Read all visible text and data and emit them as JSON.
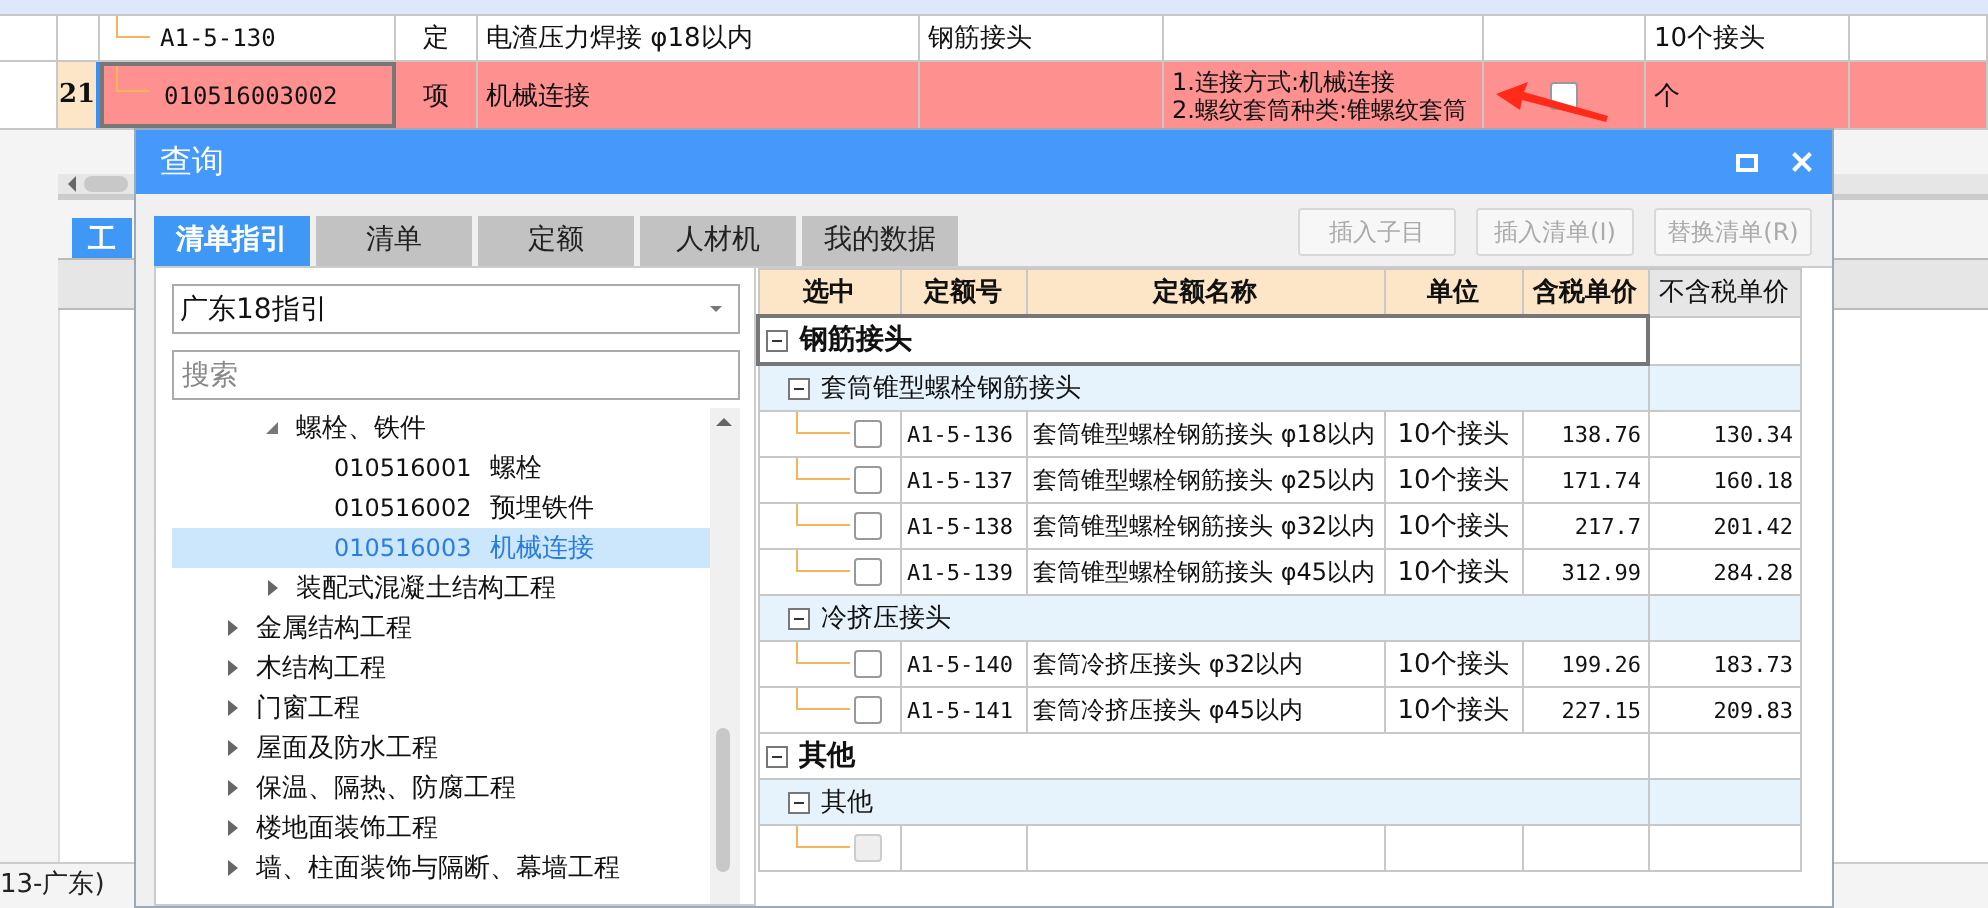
{
  "sheet": {
    "rows": [
      {
        "kind": "quota",
        "number": "",
        "code": "A1-5-130",
        "type": "定",
        "name": "电渣压力焊接 φ18以内",
        "column_5": "钢筋接头",
        "features": [],
        "unit": "10个接头",
        "highlighted": false
      },
      {
        "kind": "item",
        "number": "21",
        "code": "010516003002",
        "type": "项",
        "name": "机械连接",
        "column_5": "",
        "features": [
          "1.连接方式:机械连接",
          "2.螺纹套筒种类:锥螺纹套筒"
        ],
        "checkbox": {
          "checked": false
        },
        "unit": "个",
        "highlighted": true
      }
    ],
    "bottom_tab": {
      "label": "工",
      "selected": true
    },
    "status_bar": "13-广东)"
  },
  "dialog": {
    "title": "查询",
    "tabs": [
      {
        "label": "清单指引",
        "selected": true
      },
      {
        "label": "清单",
        "selected": false
      },
      {
        "label": "定额",
        "selected": false
      },
      {
        "label": "人材机",
        "selected": false
      },
      {
        "label": "我的数据",
        "selected": false
      }
    ],
    "buttons": [
      {
        "label": "插入子目",
        "disabled": true
      },
      {
        "label": "插入清单(I)",
        "disabled": true
      },
      {
        "label": "替换清单(R)",
        "disabled": true
      }
    ],
    "guide": {
      "value": "广东18指引"
    },
    "search": {
      "placeholder": "搜索"
    },
    "tree": {
      "continued_children": [
        {
          "label": "螺栓、铁件",
          "expanded": true,
          "children": [
            {
              "code": "010516001",
              "label": "螺栓",
              "selected": false
            },
            {
              "code": "010516002",
              "label": "预埋铁件",
              "selected": false
            },
            {
              "code": "010516003",
              "label": "机械连接",
              "selected": true
            }
          ]
        },
        {
          "label": "装配式混凝土结构工程",
          "expanded": false
        }
      ],
      "items": [
        {
          "label": "金属结构工程",
          "expanded": false
        },
        {
          "label": "木结构工程",
          "expanded": false
        },
        {
          "label": "门窗工程",
          "expanded": false
        },
        {
          "label": "屋面及防水工程",
          "expanded": false
        },
        {
          "label": "保温、隔热、防腐工程",
          "expanded": false
        },
        {
          "label": "楼地面装饰工程",
          "expanded": false
        },
        {
          "label": "墙、柱面装饰与隔断、幕墙工程",
          "expanded": false
        }
      ]
    },
    "table": {
      "columns": [
        {
          "label": "选中",
          "highlighted": true
        },
        {
          "label": "定额号",
          "highlighted": true
        },
        {
          "label": "定额名称",
          "highlighted": true
        },
        {
          "label": "单位",
          "highlighted": true
        },
        {
          "label": "含税单价",
          "highlighted": true
        },
        {
          "label": "不含税单价",
          "highlighted": false
        }
      ],
      "groups": [
        {
          "label": "钢筋接头",
          "expanded": true,
          "selected": true,
          "children": [
            {
              "label": "套筒锥型螺栓钢筋接头",
              "expanded": true,
              "children": [
                {
                  "checked": false,
                  "disabled": false,
                  "code": "A1-5-136",
                  "name": "套筒锥型螺栓钢筋接头 φ18以内",
                  "unit": "10个接头",
                  "price_with_tax": "138.76",
                  "price_without_tax": "130.34"
                },
                {
                  "checked": false,
                  "disabled": false,
                  "code": "A1-5-137",
                  "name": "套筒锥型螺栓钢筋接头 φ25以内",
                  "unit": "10个接头",
                  "price_with_tax": "171.74",
                  "price_without_tax": "160.18"
                },
                {
                  "checked": false,
                  "disabled": false,
                  "code": "A1-5-138",
                  "name": "套筒锥型螺栓钢筋接头 φ32以内",
                  "unit": "10个接头",
                  "price_with_tax": "217.7",
                  "price_without_tax": "201.42"
                },
                {
                  "checked": false,
                  "disabled": false,
                  "code": "A1-5-139",
                  "name": "套筒锥型螺栓钢筋接头 φ45以内",
                  "unit": "10个接头",
                  "price_with_tax": "312.99",
                  "price_without_tax": "284.28"
                }
              ]
            },
            {
              "label": "冷挤压接头",
              "expanded": true,
              "children": [
                {
                  "checked": false,
                  "disabled": false,
                  "code": "A1-5-140",
                  "name": "套筒冷挤压接头 φ32以内",
                  "unit": "10个接头",
                  "price_with_tax": "199.26",
                  "price_without_tax": "183.73"
                },
                {
                  "checked": false,
                  "disabled": false,
                  "code": "A1-5-141",
                  "name": "套筒冷挤压接头 φ45以内",
                  "unit": "10个接头",
                  "price_with_tax": "227.15",
                  "price_without_tax": "209.83"
                }
              ]
            }
          ]
        },
        {
          "label": "其他",
          "expanded": true,
          "selected": false,
          "children": [
            {
              "label": "其他",
              "expanded": true,
              "children": [
                {
                  "checked": false,
                  "disabled": true
                }
              ]
            }
          ]
        }
      ]
    }
  }
}
